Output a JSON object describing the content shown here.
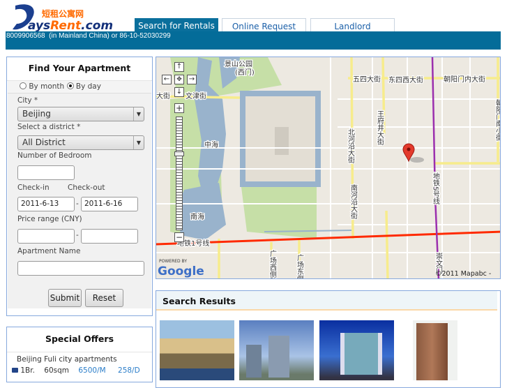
{
  "header": {
    "logo_text": "DaysRent.com",
    "logo_chinese": "短租公寓网",
    "tabs": [
      {
        "label": "Search for Rentals",
        "active": true
      },
      {
        "label": "Online Request",
        "active": false
      },
      {
        "label": "Landlord",
        "active": false
      }
    ],
    "phone_line": "8009906568  (in Mainland China) or 86-10-52030299"
  },
  "search_form": {
    "title": "Find Your Apartment",
    "rent_mode": {
      "options": [
        "By month",
        "By day"
      ],
      "selected": "By day"
    },
    "city_label": "City *",
    "city_value": "Beijing",
    "district_label": "Select a district *",
    "district_value": "All District",
    "bedroom_label": "Number of Bedroom",
    "bedroom_value": "",
    "checkin_label": "Check-in",
    "checkout_label": "Check-out",
    "checkin_value": "2011-6-13",
    "checkout_value": "2011-6-16",
    "dash": "-",
    "price_label": "Price range (CNY)",
    "price_min": "",
    "price_max": "",
    "name_label": "Apartment Name",
    "name_value": "",
    "submit_label": "Submit",
    "reset_label": "Reset"
  },
  "special_offers": {
    "title": "Special Offers",
    "items": [
      {
        "name": "Beijing Fuli city apartments",
        "bedrooms": "1Br.",
        "size": "60sqm",
        "monthly": "6500/M",
        "daily": "258/D"
      }
    ]
  },
  "map": {
    "labels": [
      "景山公园",
      "(西门)",
      "五四大街",
      "东四西大街",
      "朝阳门内大街",
      "文津街",
      "大街",
      "王府井大街",
      "北河沿大街",
      "南河沿大街",
      "中海",
      "南海",
      "地铁5号线",
      "地铁1号线",
      "广场西侧路",
      "广场东侧",
      "崇文门",
      "朝阳门南小街"
    ],
    "powered_by": "POWERED BY",
    "google": "Google",
    "copyright": "©2011 Mapabc -",
    "colors": {
      "land": "#ede9e1",
      "water": "#99b3cc",
      "park": "#c6dfa7",
      "arterial": "#f7ec8c",
      "metro1": "#ff2a00",
      "metro5": "#9b2fae"
    }
  },
  "results": {
    "title": "Search Results",
    "accent": "#fad8a8",
    "thumbnails": [
      "apartment-photo-1",
      "apartment-photo-2",
      "apartment-photo-3",
      "apartment-photo-4"
    ]
  }
}
